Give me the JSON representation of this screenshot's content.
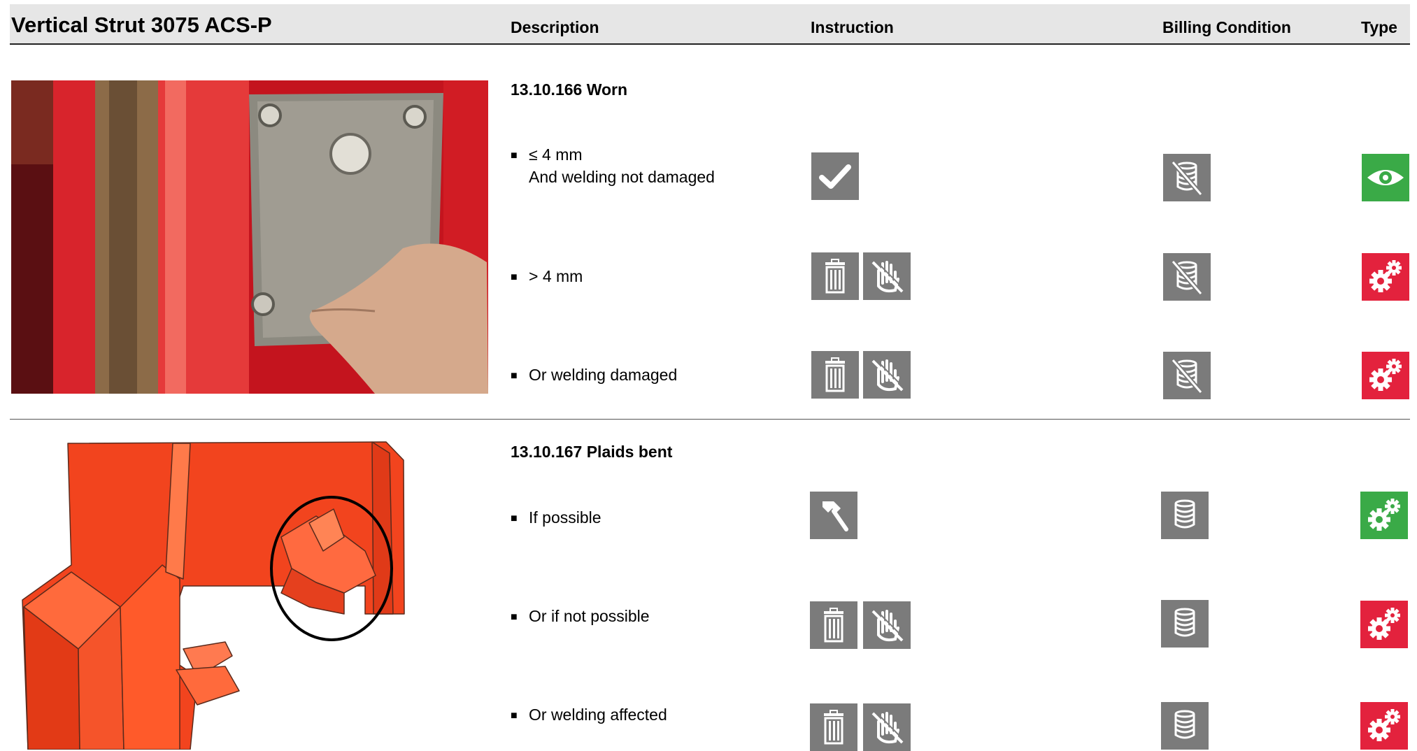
{
  "header": {
    "title": "Vertical Strut 3075 ACS-P",
    "columns": {
      "description": "Description",
      "instruction": "Instruction",
      "billing": "Billing Condition",
      "type": "Type"
    }
  },
  "sections": [
    {
      "title": "13.10.166 Worn",
      "image": "worn-strut-photo",
      "rows": [
        {
          "line1": "≤ 4 mm",
          "line2": "And welding not damaged",
          "instruction_icons": [
            "checkmark-icon"
          ],
          "billing_icon": "coins-crossed-icon",
          "type_icon": "eye-icon",
          "type_color": "#3aaa47"
        },
        {
          "line1": "> 4 mm",
          "instruction_icons": [
            "trash-icon",
            "no-hand-icon"
          ],
          "billing_icon": "coins-crossed-icon",
          "type_icon": "gears-icon",
          "type_color": "#e3223d"
        },
        {
          "line1": "Or welding damaged",
          "instruction_icons": [
            "trash-icon",
            "no-hand-icon"
          ],
          "billing_icon": "coins-crossed-icon",
          "type_icon": "gears-icon",
          "type_color": "#e3223d"
        }
      ]
    },
    {
      "title": "13.10.167 Plaids bent",
      "image": "plaids-bent-diagram",
      "rows": [
        {
          "line1": "If possible",
          "instruction_icons": [
            "hammer-icon"
          ],
          "billing_icon": "coins-icon",
          "type_icon": "gears-icon",
          "type_color": "#3aaa47"
        },
        {
          "line1": "Or if not possible",
          "instruction_icons": [
            "trash-icon",
            "no-hand-icon"
          ],
          "billing_icon": "coins-icon",
          "type_icon": "gears-icon",
          "type_color": "#e3223d"
        },
        {
          "line1": "Or welding affected",
          "instruction_icons": [
            "trash-icon",
            "no-hand-icon"
          ],
          "billing_icon": "coins-icon",
          "type_icon": "gears-icon",
          "type_color": "#e3223d"
        }
      ]
    }
  ]
}
